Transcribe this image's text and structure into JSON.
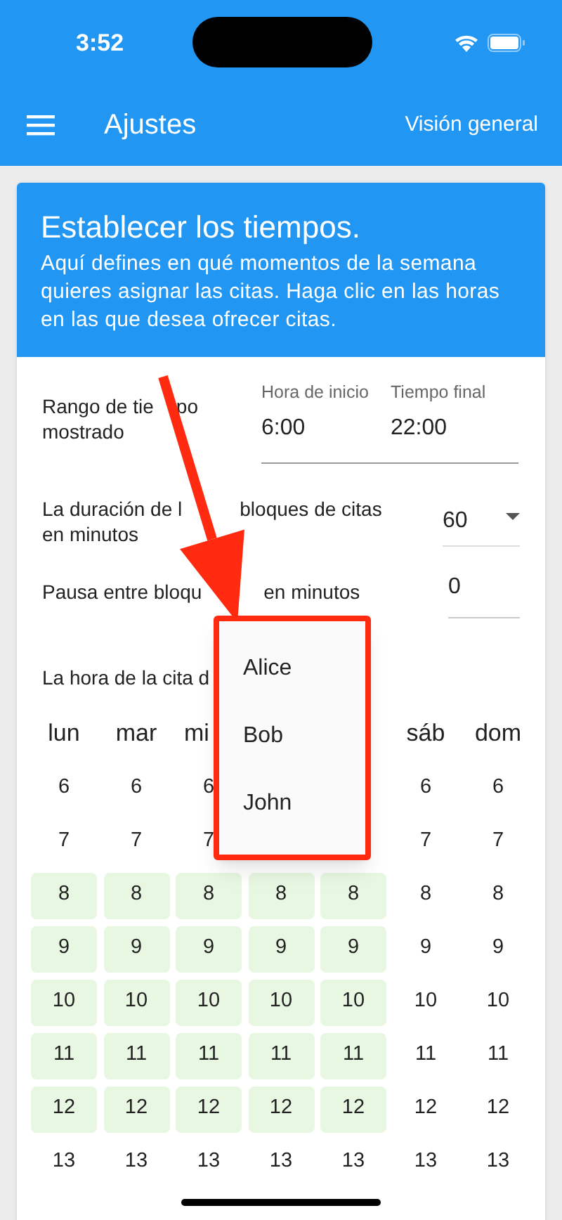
{
  "status_bar": {
    "time": "3:52"
  },
  "app_bar": {
    "title": "Ajustes",
    "action": "Visión general"
  },
  "card": {
    "title": "Establecer los tiempos.",
    "description": "Aquí defines en qué momentos de la semana quieres asignar las citas. Haga clic en las horas en las que desea ofrecer citas."
  },
  "time_range": {
    "label": [
      [
        "Rango de tie",
        "po"
      ],
      [
        "mostrado"
      ]
    ],
    "start": {
      "label": "Hora de inicio",
      "value": "6:00"
    },
    "end": {
      "label": "Tiempo final",
      "value": "22:00"
    }
  },
  "block_duration": {
    "label": [
      [
        "La duración de l",
        "bloques de citas"
      ],
      [
        "en minutos"
      ]
    ],
    "value": "60"
  },
  "pause": {
    "label": [
      [
        "Pausa entre bloqu",
        "en minutos"
      ]
    ],
    "value": "0"
  },
  "assignee_label": "La hora de la cita d",
  "menu": {
    "items": [
      "Alice",
      "Bob",
      "John"
    ]
  },
  "days": {
    "left": [
      "lun",
      "mar"
    ],
    "cut": "mi",
    "right": [
      "sáb",
      "dom"
    ]
  },
  "hours": [
    {
      "cells": [
        {
          "text": "6",
          "selected": false
        },
        {
          "text": "6",
          "selected": false
        },
        {
          "text": "6",
          "selected": false
        }
      ],
      "right_cells": [
        {
          "text": "6",
          "selected": false
        },
        {
          "text": "6",
          "selected": false
        }
      ]
    },
    {
      "cells": [
        {
          "text": "7",
          "selected": false
        },
        {
          "text": "7",
          "selected": false
        },
        {
          "text": "7",
          "selected": false
        }
      ],
      "right_cells": [
        {
          "text": "7",
          "selected": false
        },
        {
          "text": "7",
          "selected": false
        }
      ]
    },
    {
      "cells": [
        {
          "text": "8",
          "selected": true
        },
        {
          "text": "8",
          "selected": true
        },
        {
          "text": "8",
          "selected": true
        },
        {
          "text": "8",
          "selected": true
        },
        {
          "text": "8",
          "selected": true
        },
        {
          "text": "8",
          "selected": false
        },
        {
          "text": "8",
          "selected": false
        }
      ]
    },
    {
      "cells": [
        {
          "text": "9",
          "selected": true
        },
        {
          "text": "9",
          "selected": true
        },
        {
          "text": "9",
          "selected": true
        },
        {
          "text": "9",
          "selected": true
        },
        {
          "text": "9",
          "selected": true
        },
        {
          "text": "9",
          "selected": false
        },
        {
          "text": "9",
          "selected": false
        }
      ]
    },
    {
      "cells": [
        {
          "text": "10",
          "selected": true
        },
        {
          "text": "10",
          "selected": true
        },
        {
          "text": "10",
          "selected": true
        },
        {
          "text": "10",
          "selected": true
        },
        {
          "text": "10",
          "selected": true
        },
        {
          "text": "10",
          "selected": false
        },
        {
          "text": "10",
          "selected": false
        }
      ]
    },
    {
      "cells": [
        {
          "text": "11",
          "selected": true
        },
        {
          "text": "11",
          "selected": true
        },
        {
          "text": "11",
          "selected": true
        },
        {
          "text": "11",
          "selected": true
        },
        {
          "text": "11",
          "selected": true
        },
        {
          "text": "11",
          "selected": false
        },
        {
          "text": "11",
          "selected": false
        }
      ]
    },
    {
      "cells": [
        {
          "text": "12",
          "selected": true
        },
        {
          "text": "12",
          "selected": true
        },
        {
          "text": "12",
          "selected": true
        },
        {
          "text": "12",
          "selected": true
        },
        {
          "text": "12",
          "selected": true
        },
        {
          "text": "12",
          "selected": false
        },
        {
          "text": "12",
          "selected": false
        }
      ]
    },
    {
      "cells": [
        {
          "text": "13",
          "selected": false
        },
        {
          "text": "13",
          "selected": false
        },
        {
          "text": "13",
          "selected": false
        },
        {
          "text": "13",
          "selected": false
        },
        {
          "text": "13",
          "selected": false
        },
        {
          "text": "13",
          "selected": false
        },
        {
          "text": "13",
          "selected": false
        }
      ]
    }
  ]
}
